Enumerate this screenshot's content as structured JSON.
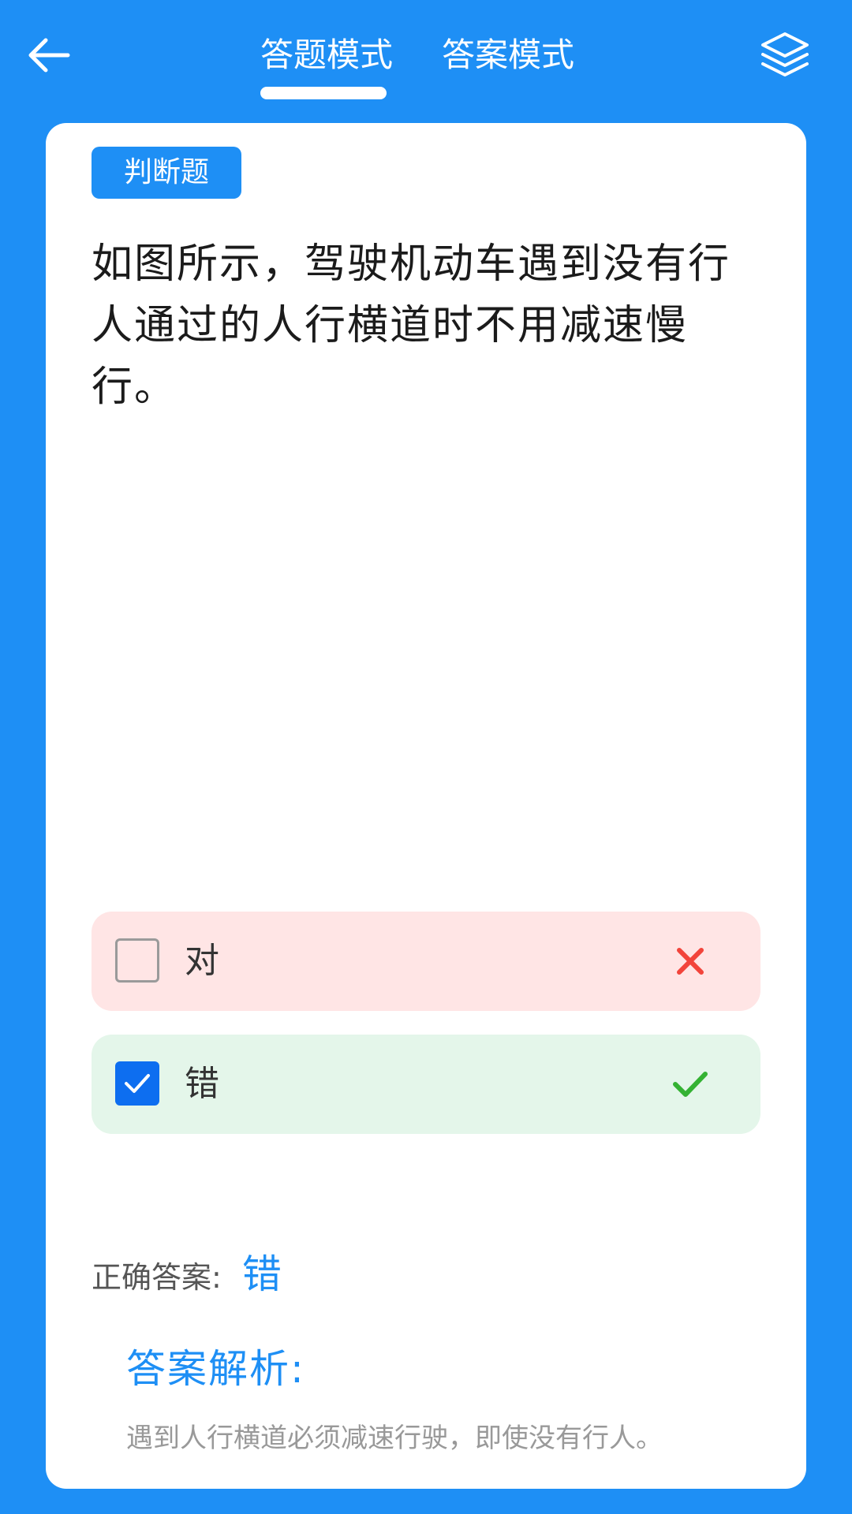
{
  "header": {
    "back_icon": "arrow-left-icon",
    "tabs": [
      {
        "label": "答题模式",
        "active": true
      },
      {
        "label": "答案模式",
        "active": false
      }
    ],
    "layers_icon": "layers-icon"
  },
  "question": {
    "type_badge": "判断题",
    "text": "如图所示，驾驶机动车遇到没有行人通过的人行横道时不用减速慢行。"
  },
  "options": [
    {
      "label": "对",
      "checked": false,
      "result": "wrong",
      "result_icon": "cross-icon"
    },
    {
      "label": "错",
      "checked": true,
      "result": "correct",
      "result_icon": "check-icon"
    }
  ],
  "answer": {
    "correct_label": "正确答案:",
    "correct_value": "错",
    "analysis_title": "答案解析:",
    "analysis_text": "遇到人行横道必须减速行驶，即使没有行人。"
  },
  "colors": {
    "primary": "#1E8FF5",
    "wrong_bg": "#FFE5E5",
    "right_bg": "#E4F6EA",
    "wrong_mark": "#F2443B",
    "right_mark": "#34B233",
    "checkbox_checked": "#0D6EF0"
  }
}
